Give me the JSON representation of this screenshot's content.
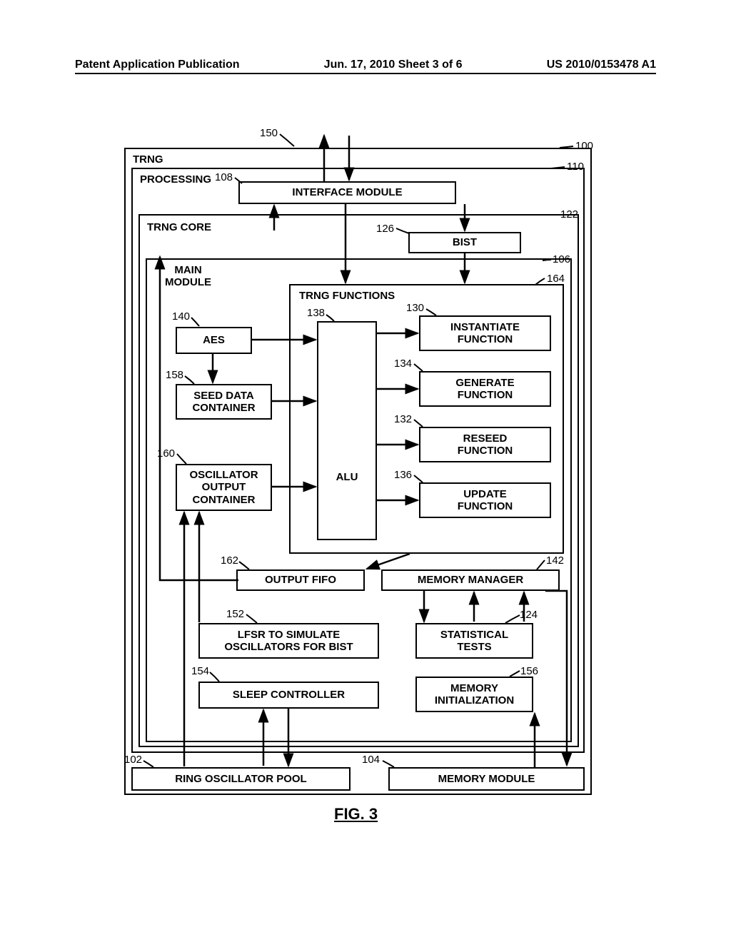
{
  "header": {
    "left": "Patent Application Publication",
    "center": "Jun. 17, 2010  Sheet 3 of 6",
    "right": "US 2010/0153478 A1"
  },
  "refs": {
    "r150": "150",
    "r100": "100",
    "r110": "110",
    "r108": "108",
    "r122": "122",
    "r126": "126",
    "r106": "106",
    "r164": "164",
    "r140": "140",
    "r138": "138",
    "r130": "130",
    "r134": "134",
    "r158": "158",
    "r132": "132",
    "r160": "160",
    "r136": "136",
    "r162": "162",
    "r142": "142",
    "r152": "152",
    "r124": "124",
    "r154": "154",
    "r156": "156",
    "r102": "102",
    "r104": "104"
  },
  "labels": {
    "trng": "TRNG",
    "processing": "PROCESSING",
    "interface_module": "INTERFACE MODULE",
    "trng_core": "TRNG CORE",
    "bist": "BIST",
    "main_module": "MAIN\nMODULE",
    "trng_functions": "TRNG FUNCTIONS",
    "aes": "AES",
    "alu": "ALU",
    "instantiate_function": "INSTANTIATE\nFUNCTION",
    "generate_function": "GENERATE\nFUNCTION",
    "reseed_function": "RESEED\nFUNCTION",
    "update_function": "UPDATE\nFUNCTION",
    "seed_data_container": "SEED DATA\nCONTAINER",
    "oscillator_output_container": "OSCILLATOR\nOUTPUT\nCONTAINER",
    "output_fifo": "OUTPUT FIFO",
    "memory_manager": "MEMORY MANAGER",
    "lfsr": "LFSR TO SIMULATE\nOSCILLATORS FOR BIST",
    "statistical_tests": "STATISTICAL\nTESTS",
    "sleep_controller": "SLEEP CONTROLLER",
    "memory_init": "MEMORY\nINITIALIZATION",
    "ring_osc_pool": "RING OSCILLATOR POOL",
    "memory_module": "MEMORY MODULE",
    "figure": "FIG. 3"
  }
}
